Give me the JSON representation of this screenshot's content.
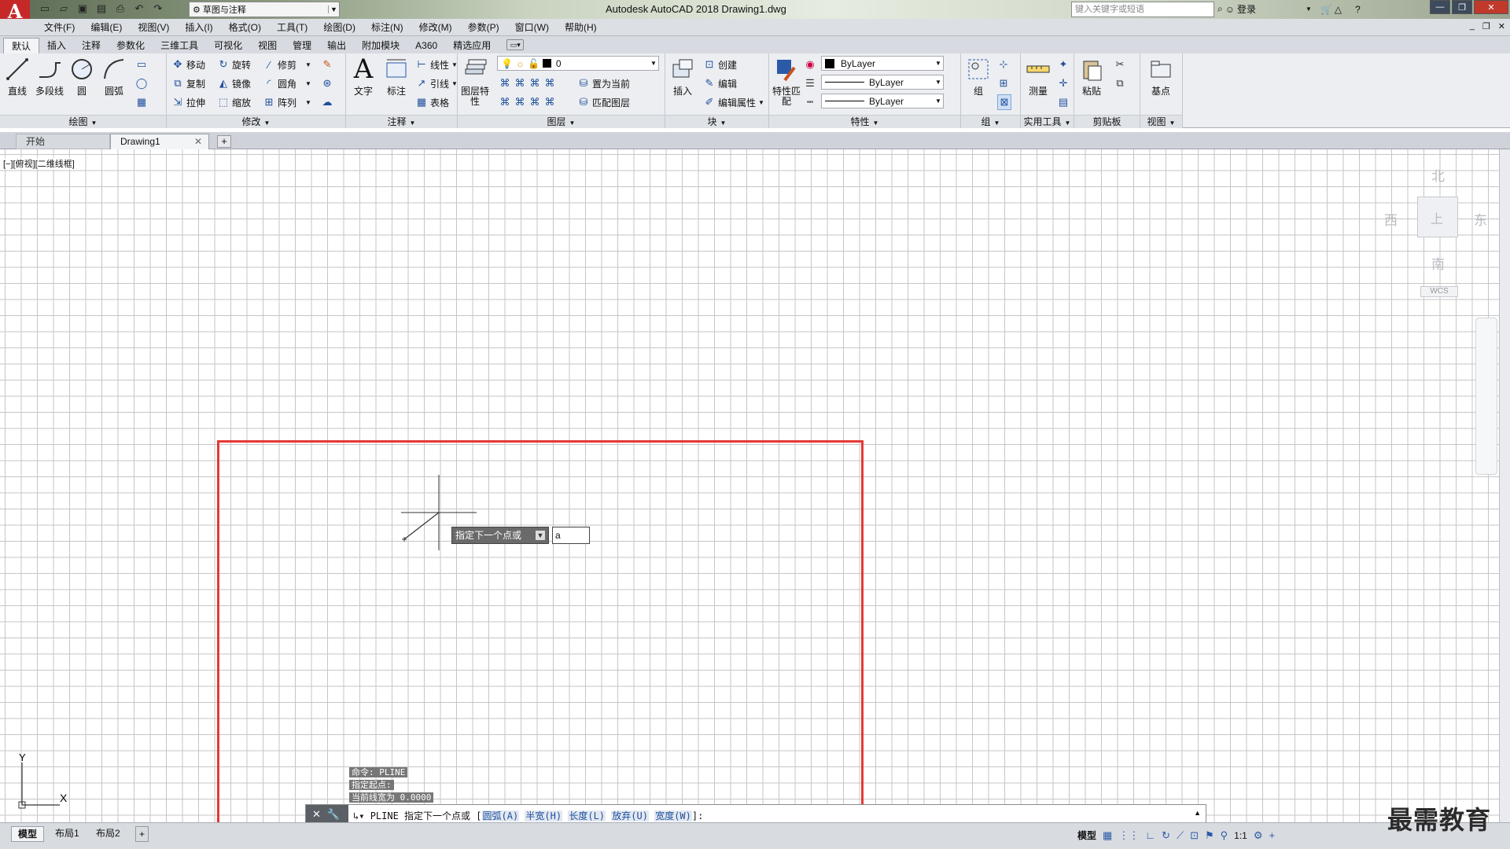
{
  "app": {
    "logo": "A",
    "title": "Autodesk AutoCAD 2018    Drawing1.dwg",
    "workspace": "草图与注释",
    "search_placeholder": "键入关键字或短语",
    "login": "登录"
  },
  "menu": [
    "文件(F)",
    "编辑(E)",
    "视图(V)",
    "插入(I)",
    "格式(O)",
    "工具(T)",
    "绘图(D)",
    "标注(N)",
    "修改(M)",
    "参数(P)",
    "窗口(W)",
    "帮助(H)"
  ],
  "ribbon_tabs": [
    "默认",
    "插入",
    "注释",
    "参数化",
    "三维工具",
    "可视化",
    "视图",
    "管理",
    "输出",
    "附加模块",
    "A360",
    "精选应用"
  ],
  "panels": {
    "draw": {
      "title": "绘图",
      "line": "直线",
      "pline": "多段线",
      "circle": "圆",
      "arc": "圆弧"
    },
    "modify": {
      "title": "修改",
      "move": "移动",
      "rotate": "旋转",
      "trim": "修剪",
      "copy": "复制",
      "mirror": "镜像",
      "fillet": "圆角",
      "stretch": "拉伸",
      "scale": "缩放",
      "array": "阵列"
    },
    "annotation": {
      "title": "注释",
      "text": "文字",
      "dimension": "标注",
      "linear": "线性",
      "leader": "引线",
      "table": "表格"
    },
    "layers": {
      "title": "图层",
      "layer_props": "图层特性",
      "current_layer": "0",
      "set_current": "置为当前",
      "match_layer": "匹配图层"
    },
    "block": {
      "title": "块",
      "insert": "插入",
      "create": "创建",
      "edit": "编辑",
      "edit_attr": "编辑属性"
    },
    "properties": {
      "title": "特性",
      "match": "特性匹配",
      "color": "ByLayer",
      "linetype": "ByLayer",
      "lineweight": "ByLayer"
    },
    "groups": {
      "title": "组",
      "group": "组"
    },
    "utilities": {
      "title": "实用工具",
      "measure": "测量"
    },
    "clipboard": {
      "title": "剪贴板",
      "paste": "粘贴"
    },
    "view": {
      "title": "视图",
      "base": "基点"
    }
  },
  "doc_tabs": {
    "start": "开始",
    "active": "Drawing1"
  },
  "viewport_label": "[−][俯视][二维线框]",
  "viewcube": {
    "north": "北",
    "south": "南",
    "east": "东",
    "west": "西",
    "top": "上",
    "wcs": "WCS"
  },
  "ucs": {
    "x": "X",
    "y": "Y"
  },
  "dynamic_input": {
    "prompt": "指定下一个点或",
    "value": "a"
  },
  "history": [
    "命令: PLINE",
    "指定起点:",
    "当前线宽为 0.0000"
  ],
  "command_line": {
    "prefix": "PLINE 指定下一个点或 [",
    "options": [
      "圆弧(A)",
      "半宽(H)",
      "长度(L)",
      "放弃(U)",
      "宽度(W)"
    ],
    "suffix": "]:"
  },
  "layout_tabs": [
    "模型",
    "布局1",
    "布局2"
  ],
  "status": {
    "model": "模型",
    "scale": "1:1"
  },
  "watermark": "最需教育",
  "colors": {
    "highlight": "#e53935",
    "logo": "#c62828"
  }
}
